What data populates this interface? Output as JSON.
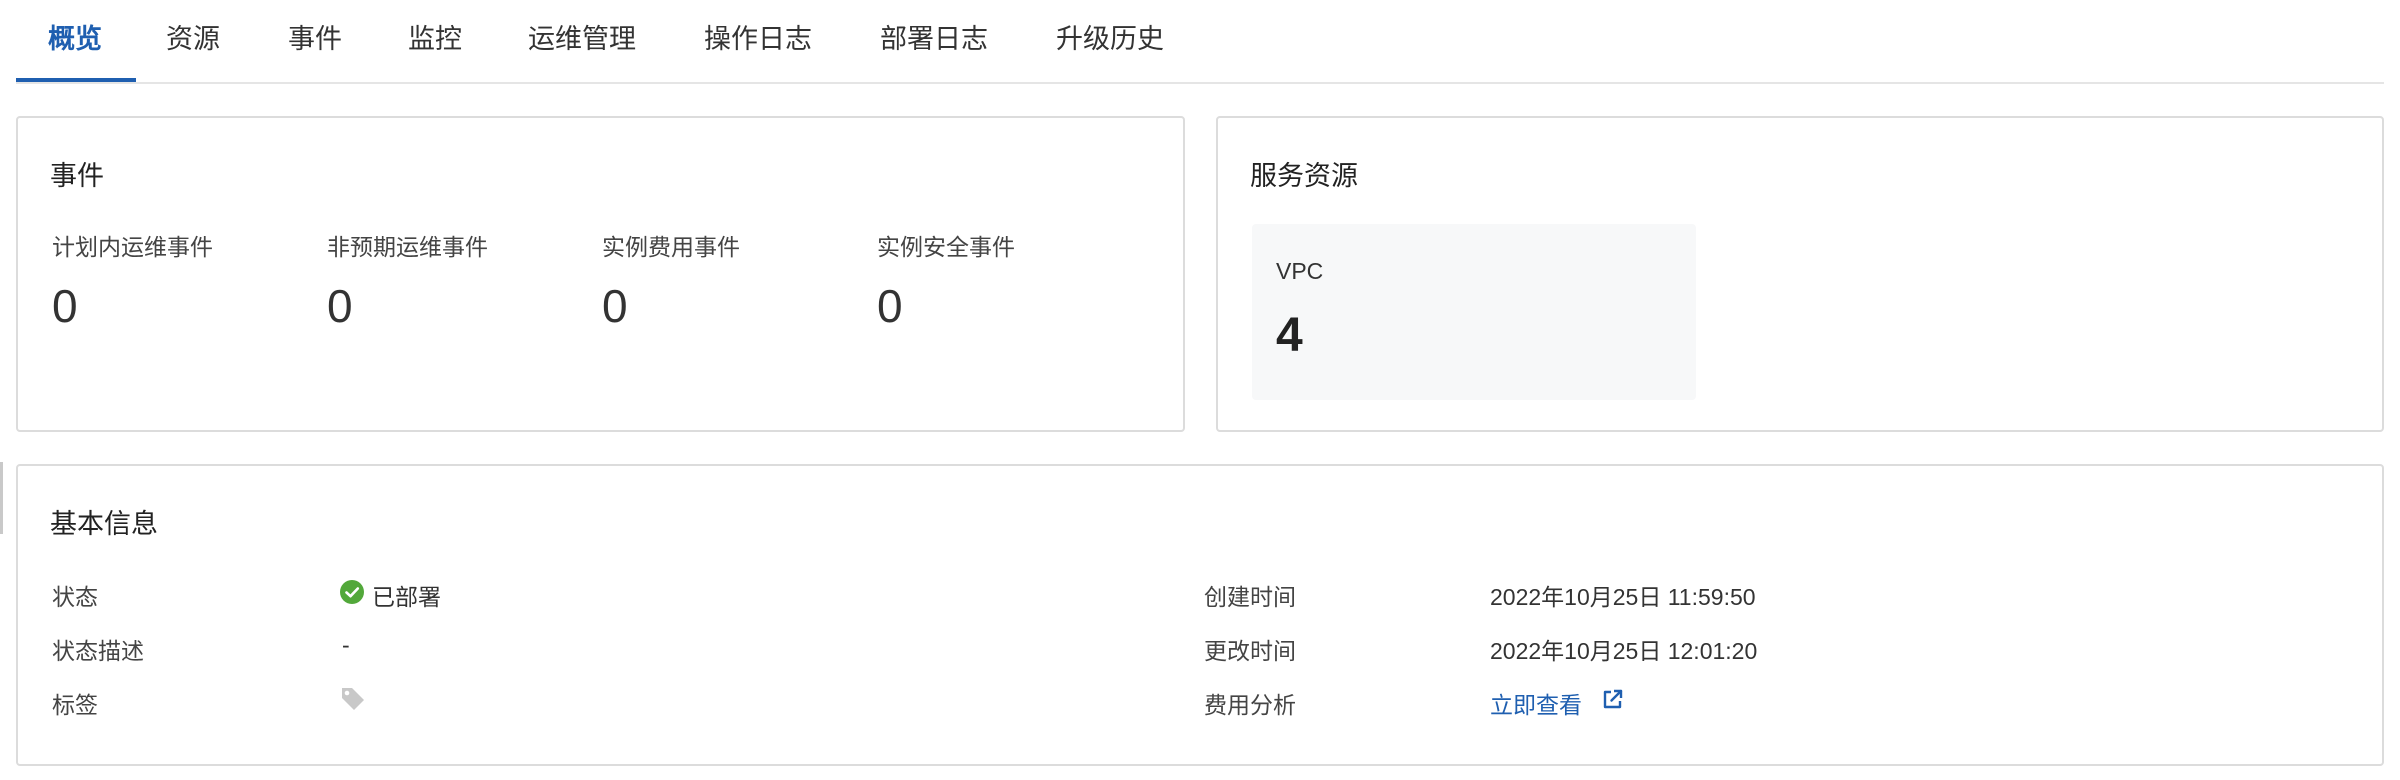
{
  "tabs": [
    "概览",
    "资源",
    "事件",
    "监控",
    "运维管理",
    "操作日志",
    "部署日志",
    "升级历史"
  ],
  "events": {
    "title": "事件",
    "items": [
      {
        "label": "计划内运维事件",
        "value": "0"
      },
      {
        "label": "非预期运维事件",
        "value": "0"
      },
      {
        "label": "实例费用事件",
        "value": "0"
      },
      {
        "label": "实例安全事件",
        "value": "0"
      }
    ]
  },
  "service_resources": {
    "title": "服务资源",
    "tile": {
      "name": "VPC",
      "count": "4"
    }
  },
  "basic_info": {
    "title": "基本信息",
    "status_label": "状态",
    "status_value": "已部署",
    "status_desc_label": "状态描述",
    "status_desc_value": "-",
    "tags_label": "标签",
    "created_label": "创建时间",
    "created_value": "2022年10月25日 11:59:50",
    "modified_label": "更改时间",
    "modified_value": "2022年10月25日 12:01:20",
    "cost_label": "费用分析",
    "cost_link": "立即查看"
  },
  "colors": {
    "accent": "#1f5fb0",
    "success": "#52a83a",
    "border": "#dcdcdc",
    "tag_icon": "#c8c8c8"
  },
  "icons": {
    "status": "check-circle-icon",
    "tags": "tag-icon",
    "cost": "external-link-icon"
  }
}
